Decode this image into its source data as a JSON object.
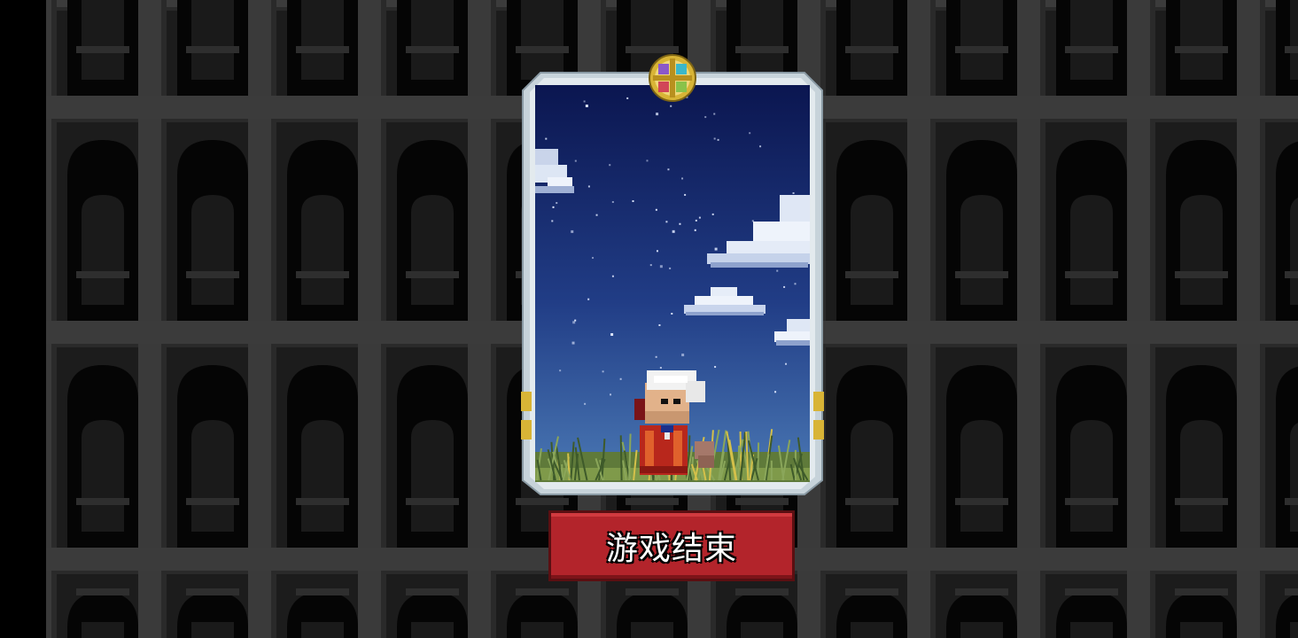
{
  "screen": "game-over",
  "card": {
    "character": "white-haired-old-man-in-red-robe",
    "scene": "night-sky-with-clouds-over-grass",
    "emblem_icon": "four-color-cross-emblem-icon"
  },
  "button": {
    "label": "游戏结束"
  },
  "colors": {
    "background": "#000000",
    "wall_dark": "#1c1c1c",
    "wall_pillar": "#3a3a3a",
    "sky_top": "#0d1a55",
    "sky_bottom": "#3e68a8",
    "card_frame": "#b8c6cf",
    "button_red": "#b3242b",
    "gold": "#d8b436"
  }
}
